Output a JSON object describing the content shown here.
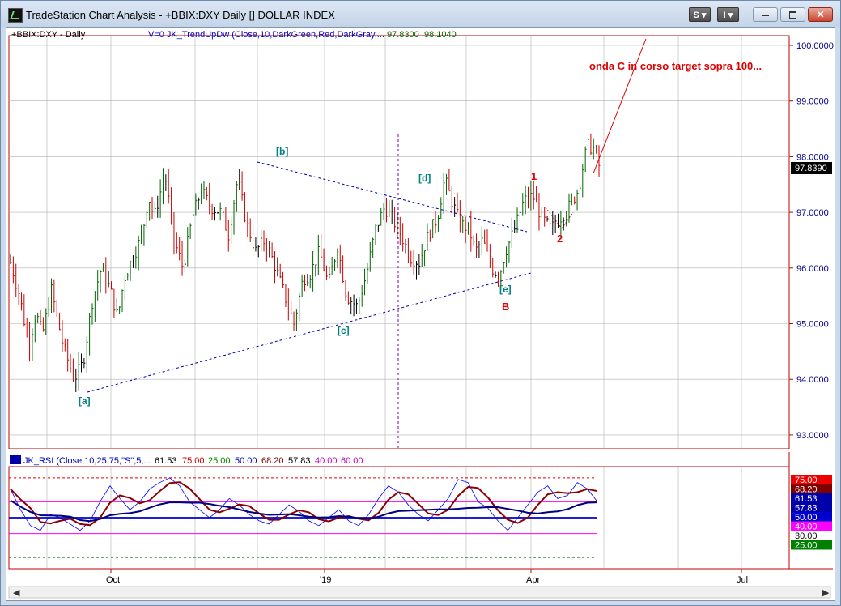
{
  "window": {
    "title": "TradeStation Chart Analysis - +BBIX:DXY Daily [] DOLLAR INDEX",
    "btn_s": "S ▾",
    "btn_i": "I ▾",
    "minimize_icon": "minimize-icon",
    "restore_icon": "restore-icon",
    "close_icon": "close-icon"
  },
  "price_panel": {
    "symbol_label": "+BBIX:DXY - Daily",
    "indicator_label": "V=0  JK_TrendUpDw (Close,10,DarkGreen,Red,DarkGray,...",
    "indicator_value_1": "97.8300",
    "indicator_value_2": "98.1040",
    "price_axis": [
      "100.0000",
      "99.0000",
      "98.0000",
      "97.0000",
      "96.0000",
      "95.0000",
      "94.0000",
      "93.0000"
    ],
    "last_price": "97.8390",
    "wave_labels": {
      "a": "[a]",
      "b": "[b]",
      "c": "[c]",
      "d": "[d]",
      "e": "[e]",
      "B": "B",
      "one": "1",
      "two": "2"
    },
    "annotation": "onda C in corso  target sopra 100..."
  },
  "rsi_panel": {
    "label": "JK_RSI (Close,10,25,75,\"S\",5,...",
    "values": [
      "61.53",
      "75.00",
      "25.00",
      "50.00",
      "68.20",
      "57.83",
      "40.00",
      "60.00"
    ],
    "value_colors": [
      "#000000",
      "#d00000",
      "#008000",
      "#0000c0",
      "#800000",
      "#000000",
      "#c000c0",
      "#c000c0"
    ],
    "axis_tags": [
      {
        "text": "75.00",
        "bg": "#ee0000",
        "color": "#ffffff"
      },
      {
        "text": "68.20",
        "bg": "#800000",
        "color": "#ffffff"
      },
      {
        "text": "61.53",
        "bg": "#0000aa",
        "color": "#ffffff"
      },
      {
        "text": "57.83",
        "bg": "#0000aa",
        "color": "#ffffff"
      },
      {
        "text": "50.00",
        "bg": "#0000cc",
        "color": "#ffffff"
      },
      {
        "text": "40.00",
        "bg": "#ff00ff",
        "color": "#ffffff"
      },
      {
        "text": "30.00",
        "bg": "#ffffff",
        "color": "#000000"
      },
      {
        "text": "25.00",
        "bg": "#008000",
        "color": "#ffffff"
      }
    ]
  },
  "time_axis": [
    "Oct",
    "'19",
    "Apr",
    "Jul"
  ],
  "colors": {
    "up_bar": "#006400",
    "down_bar": "#cc0000",
    "neutral_bar": "#000000",
    "grid": "#b0b0b0",
    "axis_text": "#00008b",
    "wave_label": "#008080",
    "wave_red": "#dd0000",
    "rsi_line": "#0000ff",
    "rsi_avg": "#8b0000",
    "rsi_slow": "#000080"
  },
  "chart_data": [
    {
      "type": "candlestick",
      "title": "+BBIX:DXY - Daily",
      "ylim": [
        92.7,
        100.3
      ],
      "x": [
        "Oct",
        "'19",
        "Apr",
        "Jul"
      ],
      "approx_close_path": [
        [
          0,
          96.1
        ],
        [
          10,
          95.5
        ],
        [
          20,
          94.6
        ],
        [
          28,
          95.2
        ],
        [
          35,
          94.8
        ],
        [
          45,
          95.6
        ],
        [
          58,
          94.6
        ],
        [
          70,
          94.0
        ],
        [
          80,
          94.3
        ],
        [
          90,
          95.4
        ],
        [
          100,
          96.0
        ],
        [
          110,
          95.6
        ],
        [
          118,
          95.1
        ],
        [
          125,
          95.8
        ],
        [
          135,
          96.2
        ],
        [
          145,
          96.6
        ],
        [
          152,
          97.3
        ],
        [
          158,
          96.9
        ],
        [
          170,
          97.7
        ],
        [
          180,
          96.5
        ],
        [
          190,
          96.0
        ],
        [
          200,
          96.9
        ],
        [
          210,
          97.4
        ],
        [
          220,
          97.1
        ],
        [
          232,
          97.0
        ],
        [
          240,
          96.6
        ],
        [
          250,
          97.6
        ],
        [
          260,
          96.8
        ],
        [
          270,
          96.3
        ],
        [
          280,
          96.5
        ],
        [
          290,
          96.1
        ],
        [
          300,
          95.6
        ],
        [
          312,
          95.0
        ],
        [
          322,
          95.8
        ],
        [
          330,
          95.9
        ],
        [
          340,
          96.3
        ],
        [
          350,
          95.7
        ],
        [
          360,
          96.4
        ],
        [
          370,
          95.5
        ],
        [
          382,
          95.3
        ],
        [
          392,
          95.9
        ],
        [
          402,
          96.7
        ],
        [
          412,
          97.1
        ],
        [
          420,
          96.9
        ],
        [
          430,
          96.6
        ],
        [
          440,
          96.2
        ],
        [
          450,
          96.1
        ],
        [
          460,
          96.6
        ],
        [
          470,
          96.9
        ],
        [
          478,
          97.6
        ],
        [
          486,
          97.2
        ],
        [
          495,
          96.8
        ],
        [
          505,
          96.7
        ],
        [
          512,
          96.3
        ],
        [
          520,
          96.5
        ],
        [
          530,
          96.0
        ],
        [
          538,
          95.85
        ],
        [
          545,
          96.3
        ],
        [
          555,
          96.7
        ],
        [
          565,
          97.2
        ],
        [
          575,
          97.3
        ],
        [
          585,
          96.9
        ],
        [
          595,
          96.7
        ],
        [
          605,
          96.9
        ],
        [
          615,
          97.1
        ],
        [
          625,
          97.4
        ],
        [
          635,
          98.2
        ],
        [
          642,
          98.15
        ],
        [
          648,
          97.84
        ]
      ]
    },
    {
      "type": "line",
      "title": "JK_RSI (Close,10,25,75,\"S\",5,...",
      "ylim": [
        20,
        80
      ],
      "series": [
        {
          "name": "",
          "values": [
            68,
            55,
            45,
            42,
            52,
            50,
            46,
            42,
            48,
            60,
            70,
            62,
            55,
            60,
            68,
            72,
            75,
            70,
            60,
            55,
            50,
            55,
            62,
            58,
            52,
            48,
            46,
            52,
            58,
            54,
            48,
            45,
            50,
            55,
            48,
            45,
            52,
            62,
            70,
            66,
            58,
            52,
            48,
            55,
            62,
            74,
            72,
            60,
            56,
            48,
            42,
            50,
            58,
            66,
            70,
            62,
            64,
            72,
            68,
            60
          ]
        }
      ]
    }
  ]
}
